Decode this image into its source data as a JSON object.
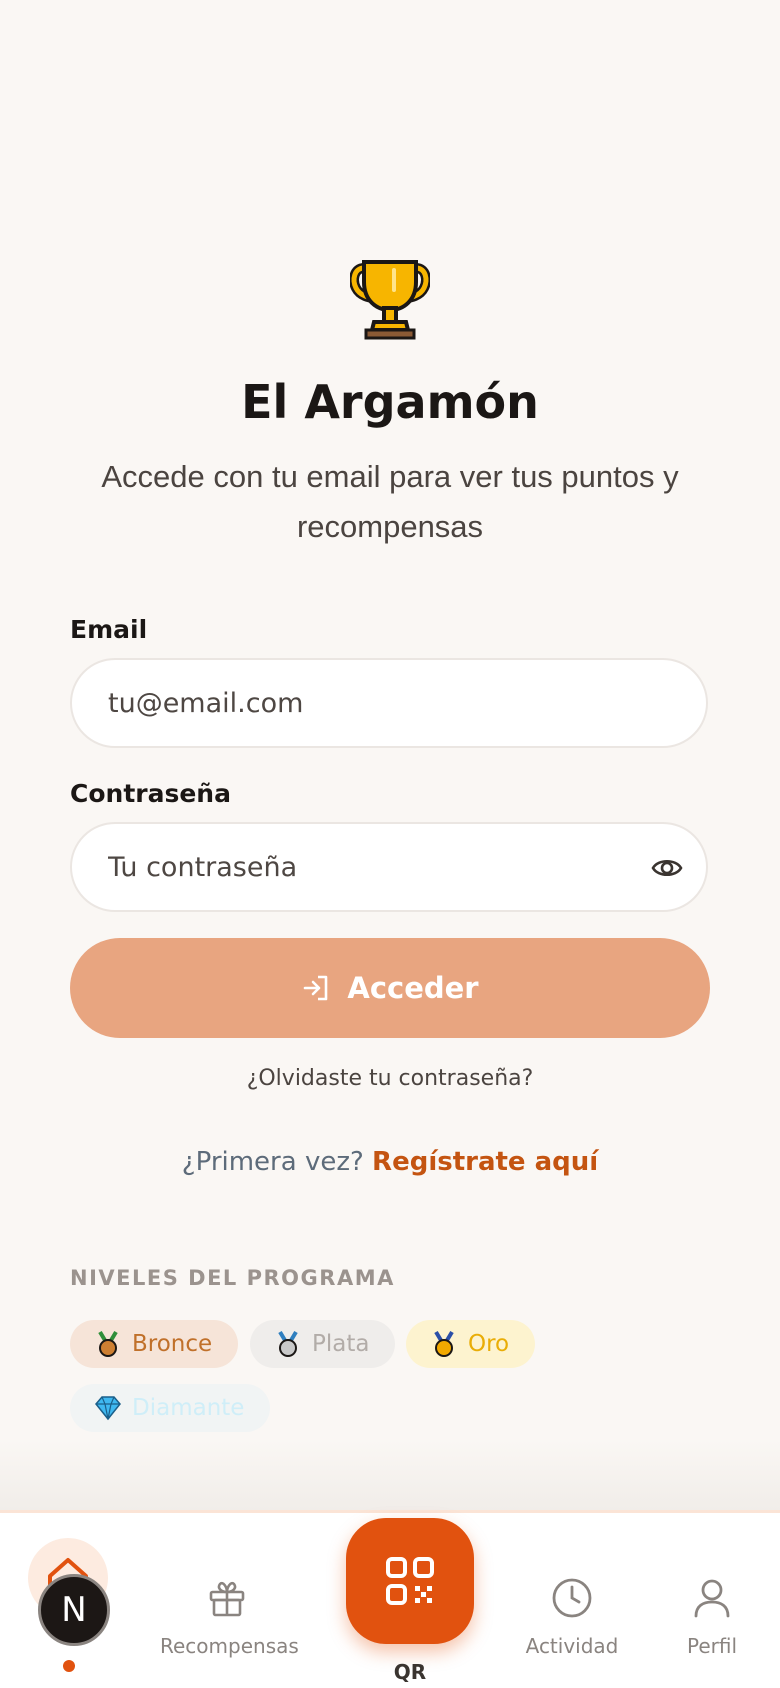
{
  "header": {
    "icon": "trophy-icon",
    "title": "El Argamón",
    "subtitle": "Accede con tu email para ver tus puntos y recompensas"
  },
  "form": {
    "email_label": "Email",
    "email_placeholder": "tu@email.com",
    "password_label": "Contraseña",
    "password_placeholder": "Tu contraseña",
    "submit_label": "Acceder",
    "forgot_label": "¿Olvidaste tu contraseña?",
    "register_question": "¿Primera vez?",
    "register_link": "Regístrate aquí"
  },
  "levels": {
    "title": "NIVELES DEL PROGRAMA",
    "items": [
      {
        "label": "Bronce",
        "icon": "bronze-medal-icon"
      },
      {
        "label": "Plata",
        "icon": "silver-medal-icon"
      },
      {
        "label": "Oro",
        "icon": "gold-medal-icon"
      },
      {
        "label": "Diamante",
        "icon": "diamond-icon"
      }
    ]
  },
  "nav": {
    "items": [
      {
        "label": "Recompensas",
        "icon": "gift-icon"
      },
      {
        "label": "QR",
        "icon": "qr-icon"
      },
      {
        "label": "Actividad",
        "icon": "clock-icon"
      },
      {
        "label": "Perfil",
        "icon": "user-icon"
      }
    ],
    "badge_letter": "N"
  },
  "colors": {
    "accent": "#e1520f",
    "button_disabled": "#e8a580",
    "link": "#c45411",
    "background": "#faf7f4"
  }
}
